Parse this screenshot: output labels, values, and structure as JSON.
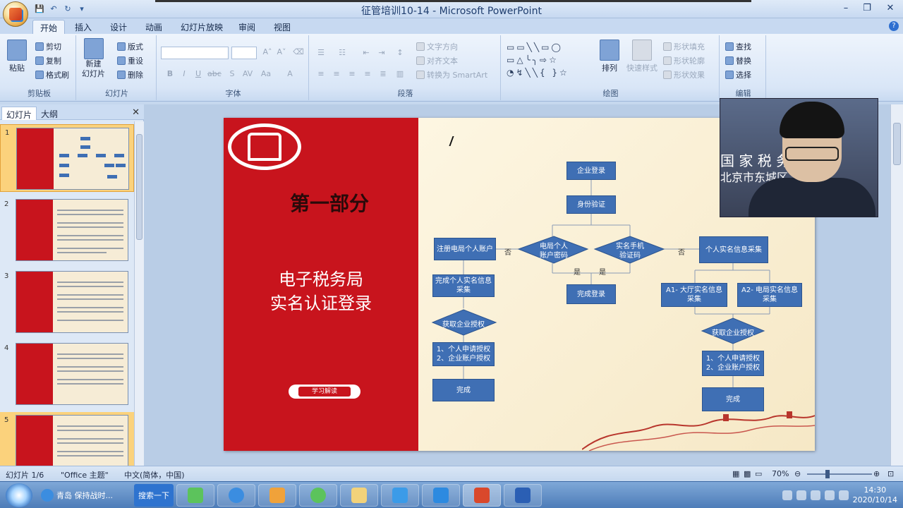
{
  "window": {
    "title": "征管培训10-14 - Microsoft PowerPoint"
  },
  "tabs": [
    "开始",
    "插入",
    "设计",
    "动画",
    "幻灯片放映",
    "审阅",
    "视图"
  ],
  "ribbon": {
    "clipboard": {
      "paste": "粘贴",
      "cut": "剪切",
      "copy": "复制",
      "format_painter": "格式刷",
      "label": "剪贴板"
    },
    "slides": {
      "new_slide_1": "新建",
      "new_slide_2": "幻灯片",
      "layout": "版式",
      "reset": "重设",
      "delete": "删除",
      "label": "幻灯片"
    },
    "font": {
      "label": "字体"
    },
    "paragraph": {
      "text_direction": "文字方向",
      "align_text": "对齐文本",
      "convert_smartart": "转换为 SmartArt",
      "label": "段落"
    },
    "drawing": {
      "arrange": "排列",
      "quick_styles": "快速样式",
      "shape_fill": "形状填充",
      "shape_outline": "形状轮廓",
      "shape_effects": "形状效果",
      "label": "绘图"
    },
    "editing": {
      "find": "查找",
      "replace": "替换",
      "select": "选择",
      "label": "编辑"
    }
  },
  "pane": {
    "tab_slides": "幻灯片",
    "tab_outline": "大纲",
    "thumbnails": [
      "1",
      "2",
      "3",
      "4",
      "5"
    ]
  },
  "slide": {
    "part": "第一部分",
    "title_line1": "电子税务局",
    "title_line2": "实名认证登录",
    "ribbon_tag": "学习解读",
    "flow": {
      "enterprise_login": "企业登录",
      "identity_verify": "身份验证",
      "decision_left_1": "电局个人",
      "decision_left_2": "账户密码",
      "decision_right_1": "实名手机",
      "decision_right_2": "验证码",
      "register_account": "注册电局个人账户",
      "no_left": "否",
      "no_right": "否",
      "yes_left": "是",
      "yes_right": "是",
      "complete_login": "完成登录",
      "personal_info": "个人实名信息采集",
      "complete_realname_1": "完成个人实名信息",
      "complete_realname_2": "采集",
      "get_auth_left": "获取企业授权",
      "get_auth_right": "获取企业授权",
      "a1_1": "A1- 大厅实名信息",
      "a1_2": "采集",
      "a2_1": "A2- 电局实名信息",
      "a2_2": "采集",
      "auth_steps_1": "1、个人申请授权",
      "auth_steps_2": "2、企业账户授权",
      "done": "完成"
    }
  },
  "webcam": {
    "text_line1": "国 家 税 务",
    "text_line2": "北京市东城区"
  },
  "statusbar": {
    "slide_count": "幻灯片 1/6",
    "theme": "\"Office 主题\"",
    "language": "中文(简体，中国)",
    "zoom": "70%"
  },
  "taskbar": {
    "ie_label": "青岛 保持战时...",
    "search": "搜索一下",
    "time": "14:30",
    "date": "2020/10/14"
  },
  "colors": {
    "slide_red": "#c8141d",
    "flow_blue": "#3f6fb4"
  }
}
